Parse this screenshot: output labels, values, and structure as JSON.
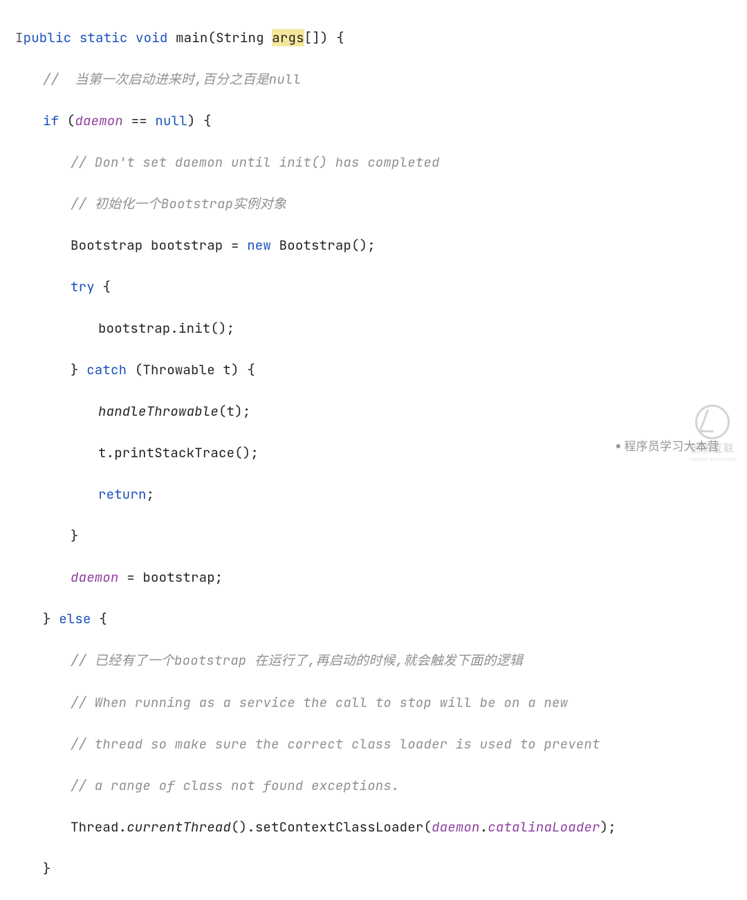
{
  "code": {
    "l1": {
      "caret": "I",
      "kw1": "public",
      "kw2": "static",
      "kw3": "void",
      "fn": "main",
      "lp": "(String ",
      "arg": "args",
      "rp": "[]) {"
    },
    "l2": {
      "txt": "//  当第一次启动进来时,百分之百是null"
    },
    "l3": {
      "kw": "if",
      "lp": " (",
      "id": "daemon",
      "mid": " == ",
      "kw2": "null",
      "rp": ") {"
    },
    "l4": {
      "txt": "// Don't set daemon until init() has completed"
    },
    "l5": {
      "txt": "// 初始化一个Bootstrap实例对象"
    },
    "l6": {
      "a": "Bootstrap bootstrap = ",
      "kw": "new",
      "b": " Bootstrap();"
    },
    "l7": {
      "kw": "try",
      "b": " {"
    },
    "l8": {
      "txt": "bootstrap.init();"
    },
    "l9": {
      "a": "} ",
      "kw": "catch",
      "b": " (Throwable t) {"
    },
    "l10": {
      "fn": "handleThrowable",
      "b": "(t);"
    },
    "l11": {
      "txt": "t.printStackTrace();"
    },
    "l12": {
      "kw": "return",
      "b": ";"
    },
    "l13": {
      "txt": "}"
    },
    "l14": {
      "id": "daemon",
      "b": " = bootstrap;"
    },
    "l15": {
      "a": "} ",
      "kw": "else",
      "b": " {"
    },
    "l16": {
      "txt": "// 已经有了一个bootstrap 在运行了,再启动的时候,就会触发下面的逻辑"
    },
    "l17": {
      "txt": "// When running as a service the call to stop will be on a new"
    },
    "l18": {
      "txt": "// thread so make sure the correct class loader is used to prevent"
    },
    "l19": {
      "txt": "// a range of class not found exceptions."
    },
    "l20": {
      "a": "Thread.",
      "fn1": "currentThread",
      "b": "().setContextClassLoader(",
      "id1": "daemon",
      "c": ".",
      "id2": "catalinaLoader",
      "d": ");"
    },
    "l21": {
      "txt": "}"
    }
  },
  "watermark": {
    "text": "程序员学习大本营",
    "brand_cn": "创新互联",
    "brand_en": "CHUANG XIN HULIAN"
  }
}
